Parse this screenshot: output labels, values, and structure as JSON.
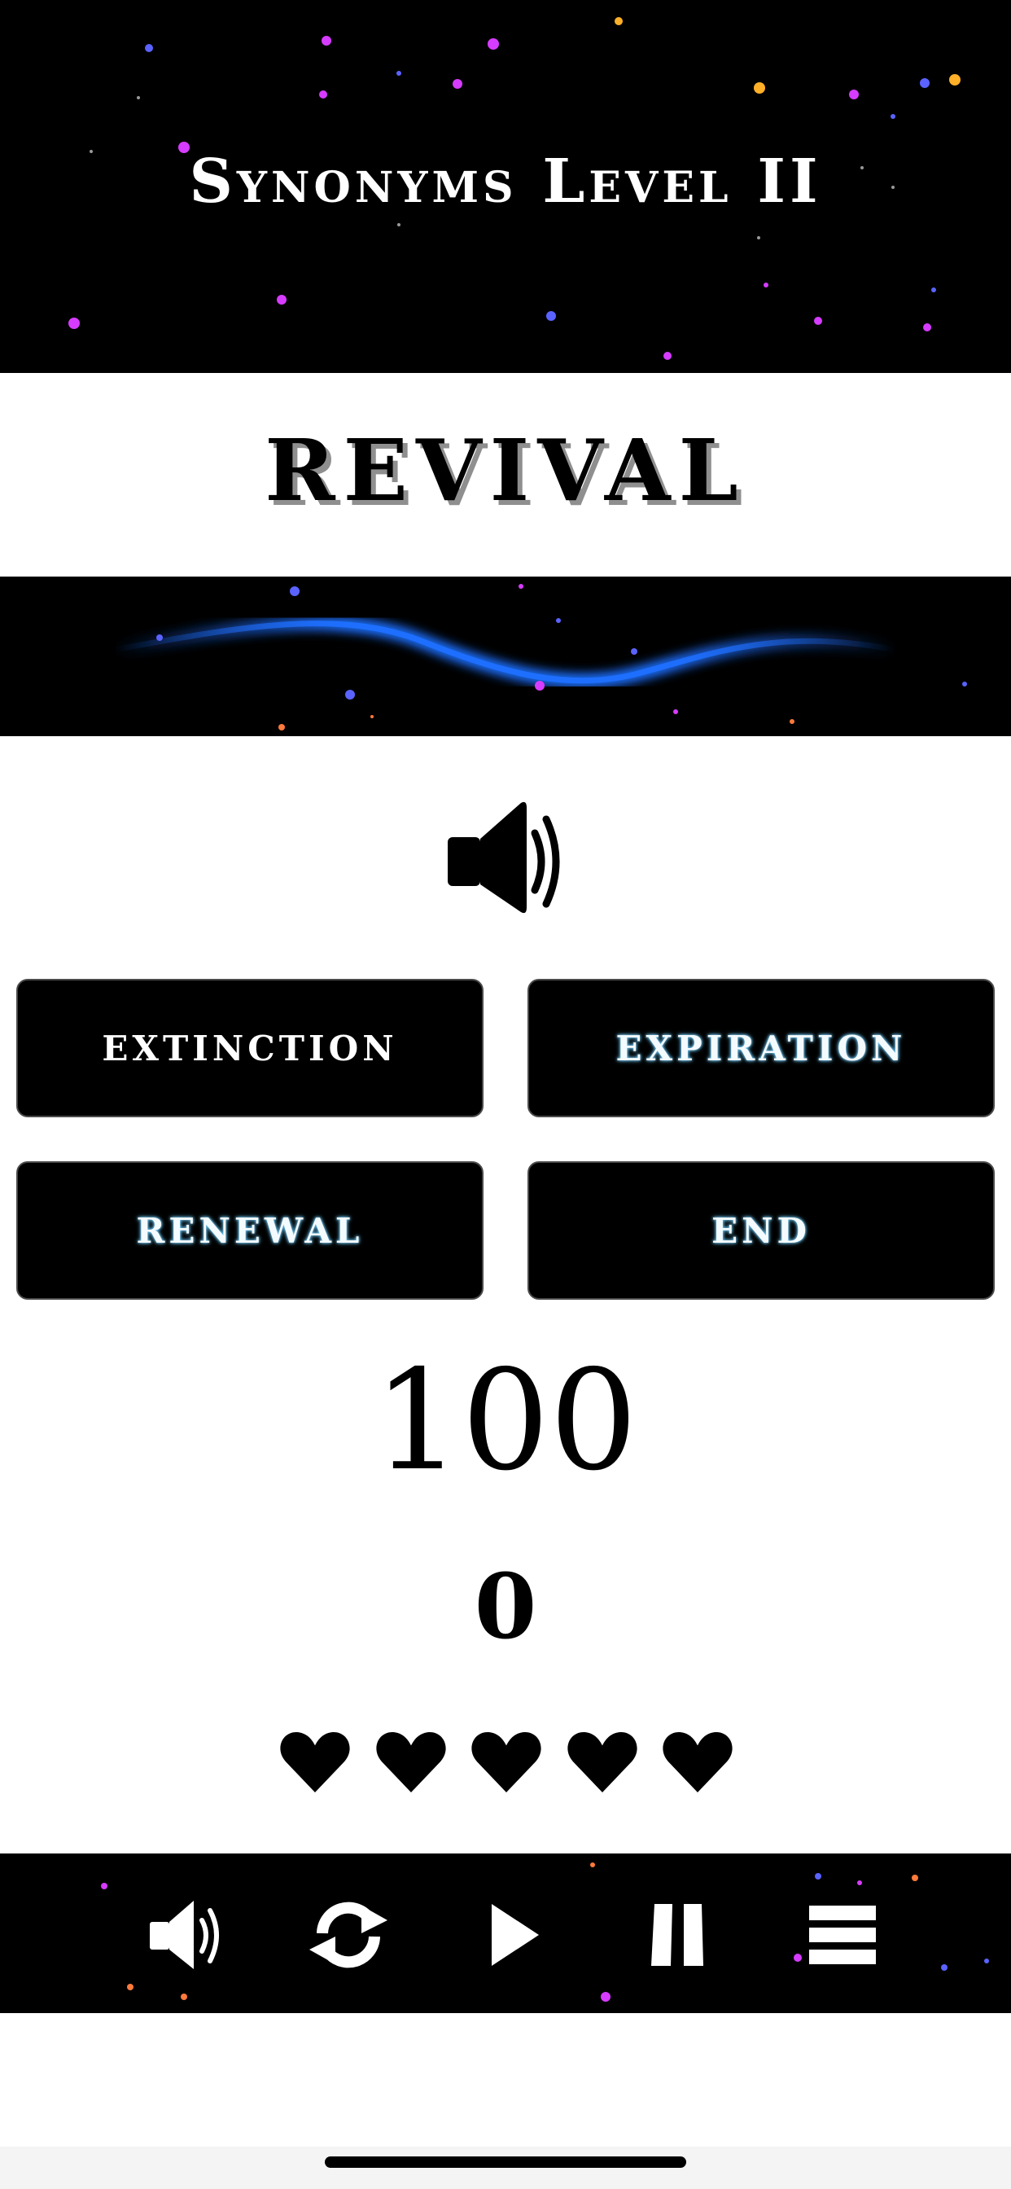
{
  "header": {
    "title": "Synonyms Level II"
  },
  "question": {
    "word": "REVIVAL"
  },
  "answers": [
    {
      "label": "EXTINCTION"
    },
    {
      "label": "EXPIRATION"
    },
    {
      "label": "RENEWAL"
    },
    {
      "label": "END"
    }
  ],
  "stats": {
    "score": "100",
    "count": "0"
  },
  "lives": {
    "remaining": 5,
    "icon": "heart-icon"
  },
  "toolbar": {
    "items": [
      {
        "icon": "speaker-icon"
      },
      {
        "icon": "refresh-icon"
      },
      {
        "icon": "play-icon"
      },
      {
        "icon": "pause-icon"
      },
      {
        "icon": "menu-icon"
      }
    ]
  },
  "colors": {
    "background": "#000000",
    "wave": "#1e6fff",
    "text_glow": "#5fc8ff"
  }
}
